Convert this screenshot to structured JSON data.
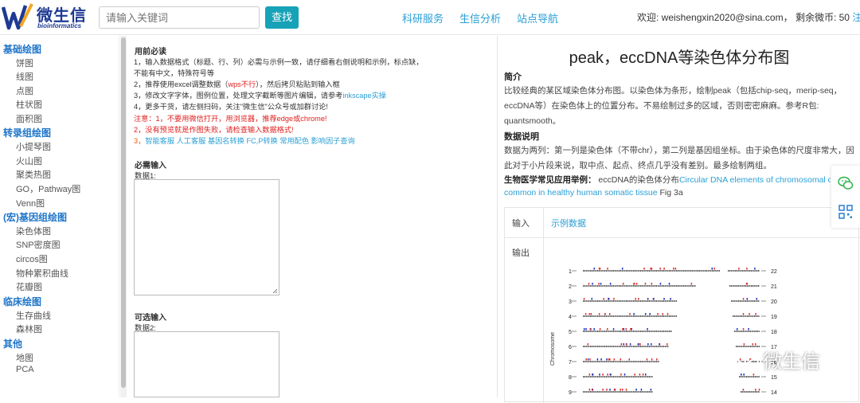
{
  "header": {
    "logo_title": "微生信",
    "logo_sub": "bioinformatics",
    "search_placeholder": "请输入关键词",
    "search_button": "查找",
    "nav": [
      "科研服务",
      "生信分析",
      "站点导航"
    ],
    "user_prefix": "欢迎: weishengxin2020@sina.com，  剩余微币: 50",
    "logout": "注销"
  },
  "sidebar": {
    "cat1": "基础绘图",
    "cat1_items": [
      "饼图",
      "线图",
      "点图",
      "柱状图",
      "面积图"
    ],
    "cat2": "转录组绘图",
    "cat2_items": [
      "小提琴图",
      "火山图",
      "聚类热图",
      "GO，Pathway图",
      "Venn图"
    ],
    "cat3": "(宏)基因组绘图",
    "cat3_items": [
      "染色体图",
      "SNP密度图",
      "circos图",
      "物种累积曲线",
      "花瓣图"
    ],
    "cat4": "临床绘图",
    "cat4_items": [
      "生存曲线",
      "森林图"
    ],
    "cat5": "其他",
    "cat5_items": [
      "地图",
      "PCA"
    ]
  },
  "middle": {
    "must_know": "用前必读",
    "line1": "1，输入数据格式（标题、行、列）必需与示例一致，请仔细看右侧说明和示例，标点缺，",
    "line1b": "不能有中文，特殊符号等",
    "line2a": "2，推荐使用excel调整数据（",
    "line2b": "wps不行",
    "line2c": "），然后拷贝粘贴到输入框",
    "line3a": "3，修改文字字体，图例位置，处理文字截断等图片编辑，请参考",
    "line3b": "inkscape实操",
    "line4": "4，更多干货，请左侧扫码，关注\"微生信\"公众号或加群讨论!",
    "warn1": "注意：1，不要用微信打开，用浏览器，推荐edge或chrome!",
    "warn2": "2，没有预览就是作图失败，请检查输入数据格式!",
    "warn3_prefix": "3，",
    "warn3_links": [
      "智能客服",
      "人工客服",
      "基因名转换",
      "FC,P转换",
      "常用配色",
      "影响因子查询"
    ],
    "required_input": "必需输入",
    "data1": "数据1:",
    "optional_input": "可选输入",
    "data2": "数据2:"
  },
  "right": {
    "title": "peak，eccDNA等染色体分布图",
    "intro_h": "简介",
    "intro_1": "比较经典的某区域染色体分布图。以染色体为条形，绘制peak（包括chip-seq，merip-seq，",
    "intro_2": "eccDNA等）在染色体上的位置分布。不易绘制过多的区域，否则密密麻麻。参考R包:",
    "intro_3": "quantsmooth。",
    "data_h": "数据说明",
    "data_1": "数据为两列：第一列是染色体（不带chr），第二列是基因组坐标。由于染色体的尺度非常大，因",
    "data_2": "此对于小片段来说，取中点、起点、终点几乎没有差别。最多绘制两组。",
    "example_h": "生物医学常见应用举例：",
    "example_a": "eccDNA的染色体分布",
    "example_link": "Circular DNA elements of chromosomal origin are",
    "example_link2": "common in healthy human somatic tissue",
    "example_tail": " Fig 3a",
    "input_label": "输入",
    "input_link": "示例数据",
    "output_label": "输出"
  },
  "chart_data": {
    "type": "scatter",
    "ylabel": "Chromosome",
    "left_labels": [
      "1",
      "2",
      "3",
      "4",
      "5",
      "6",
      "7",
      "8",
      "9"
    ],
    "right_labels": [
      "22",
      "21",
      "20",
      "19",
      "18",
      "17",
      "16",
      "15",
      "14"
    ],
    "series_colors": [
      "#e03030",
      "#2030c0"
    ]
  },
  "watermark": "微生信"
}
